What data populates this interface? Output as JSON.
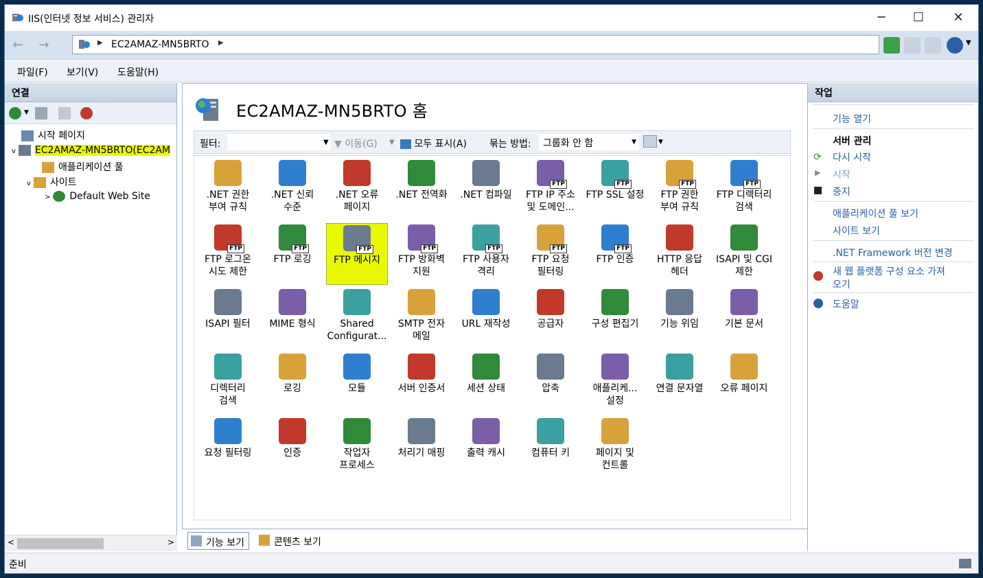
{
  "window": {
    "title": "IIS(인터넷 정보 서비스) 관리자",
    "controls": {
      "minimize": "─",
      "maximize": "☐",
      "close": "✕"
    }
  },
  "address": {
    "segment": "EC2AMAZ-MN5BRTO"
  },
  "menu": [
    "파일(F)",
    "보기(V)",
    "도움말(H)"
  ],
  "connections": {
    "header": "연결",
    "tree": [
      {
        "label": "시작 페이지"
      },
      {
        "label": "EC2AMAZ-MN5BRTO(EC2AM"
      },
      {
        "label": "애플리케이션 풀"
      },
      {
        "label": "사이트"
      },
      {
        "label": "Default Web Site"
      }
    ]
  },
  "home": {
    "title": "EC2AMAZ-MN5BRTO 홈"
  },
  "filterbar": {
    "filter_label": "필터:",
    "go": "이동(G)",
    "show_all": "모두 표시(A)",
    "group_by": "묶는 방법:",
    "group_value": "그룹화 안 함"
  },
  "features": [
    ".NET 권한\n부여 규칙",
    ".NET 신뢰\n수준",
    ".NET 오류\n페이지",
    ".NET 전역화",
    ".NET 컴파일",
    "FTP IP 주소\n및 도메인...",
    "FTP SSL 설정",
    "FTP 권한\n부여 규칙",
    "FTP 디렉터리\n검색",
    "FTP 로그온\n시도 제한",
    "FTP 로깅",
    "FTP 메시지",
    "FTP 방화벽\n지원",
    "FTP 사용자\n격리",
    "FTP 요청\n필터링",
    "FTP 인증",
    "HTTP 응답\n헤더",
    "ISAPI 및 CGI\n제한",
    "ISAPI 필터",
    "MIME 형식",
    "Shared\nConfigurat...",
    "SMTP 전자\n메일",
    "URL 재작성",
    "공급자",
    "구성 편집기",
    "기능 위임",
    "기본 문서",
    "디렉터리\n검색",
    "로깅",
    "모듈",
    "서버 인증서",
    "세션 상태",
    "압축",
    "애플리케...\n설정",
    "연결 문자열",
    "오류 페이지",
    "요청 필터링",
    "인증",
    "작업자\n프로세스",
    "처리기 매핑",
    "출력 캐시",
    "컴퓨터 키",
    "페이지 및\n컨트롤"
  ],
  "view_tabs": {
    "features": "기능 보기",
    "content": "콘텐츠 보기"
  },
  "actions": {
    "header": "작업",
    "open_feature": "기능 열기",
    "server_manage": "서버 관리",
    "restart": "다시 시작",
    "start": "시작",
    "stop": "중지",
    "view_app_pools": "애플리케이션 풀 보기",
    "view_sites": "사이트 보기",
    "change_net": ".NET Framework 버전 변경",
    "get_new_platform_1": "새 웹 플랫폼 구성 요소 가져",
    "get_new_platform_2": "오기",
    "help": "도움말"
  },
  "status": {
    "text": "준비"
  },
  "colors": {
    "accent": "#2b5ea8",
    "highlight": "#e8f900"
  }
}
